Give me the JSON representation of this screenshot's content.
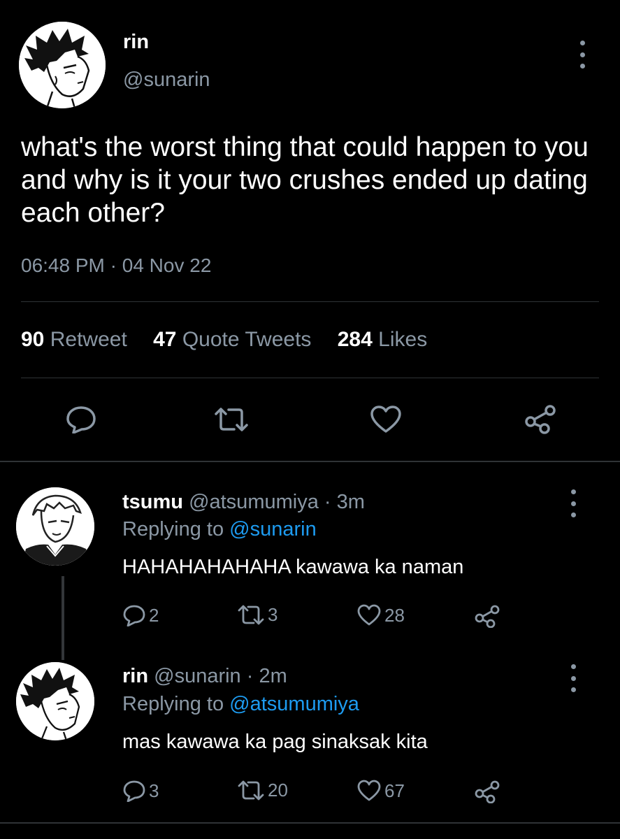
{
  "main_tweet": {
    "display_name": "rin",
    "handle": "@sunarin",
    "text": "what's the worst thing that could happen to you and why is it your two crushes ended up dating each other?",
    "time": "06:48 PM",
    "separator": "·",
    "date": "04 Nov 22",
    "stats": {
      "retweets": "90",
      "retweets_label": "Retweet",
      "quotes": "47",
      "quotes_label": "Quote Tweets",
      "likes": "284",
      "likes_label": "Likes"
    },
    "icons": [
      "reply-icon",
      "retweet-icon",
      "like-icon",
      "share-icon"
    ]
  },
  "replies": [
    {
      "display_name": "tsumu",
      "handle": "@atsumumiya",
      "separator": "·",
      "age": "3m",
      "replying_prefix": "Replying to",
      "replying_to": "@sunarin",
      "text": "HAHAHAHAHAHA kawawa ka naman",
      "reply_count": "2",
      "retweet_count": "3",
      "like_count": "28"
    },
    {
      "display_name": "rin",
      "handle": "@sunarin",
      "separator": "·",
      "age": "2m",
      "replying_prefix": "Replying to",
      "replying_to": "@atsumumiya",
      "text": "mas kawawa ka pag sinaksak kita",
      "reply_count": "3",
      "retweet_count": "20",
      "like_count": "67"
    }
  ],
  "colors": {
    "background": "#000000",
    "text_primary": "#ffffff",
    "text_secondary": "#8b98a5",
    "mention": "#1d9bf0",
    "divider": "#2f3336"
  }
}
